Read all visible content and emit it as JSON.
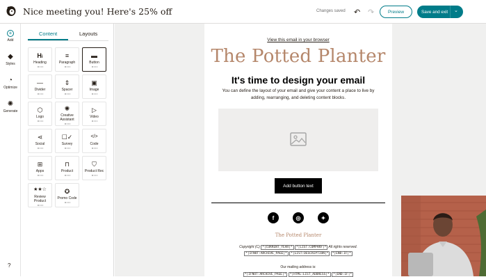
{
  "topbar": {
    "title": "Nice meeting you! Here's 25% off",
    "status": "Changes saved",
    "preview_label": "Preview",
    "save_label": "Save and exit"
  },
  "rail": {
    "add": "Add",
    "styles": "Styles",
    "optimize": "Optimize",
    "generate": "Generate"
  },
  "panel": {
    "tabs": {
      "content": "Content",
      "layouts": "Layouts"
    },
    "blocks": [
      {
        "label": "Heading",
        "icon": "heading-icon"
      },
      {
        "label": "Paragraph",
        "icon": "paragraph-icon"
      },
      {
        "label": "Button",
        "icon": "button-icon"
      },
      {
        "label": "Divider",
        "icon": "divider-icon"
      },
      {
        "label": "Spacer",
        "icon": "spacer-icon"
      },
      {
        "label": "Image",
        "icon": "image-icon"
      },
      {
        "label": "Logo",
        "icon": "logo-icon"
      },
      {
        "label": "Creative Assistant",
        "icon": "creative-assistant-icon"
      },
      {
        "label": "Video",
        "icon": "video-icon"
      },
      {
        "label": "Social",
        "icon": "social-icon"
      },
      {
        "label": "Survey",
        "icon": "survey-icon"
      },
      {
        "label": "Code",
        "icon": "code-icon"
      },
      {
        "label": "Apps",
        "icon": "apps-icon"
      },
      {
        "label": "Product",
        "icon": "product-icon"
      },
      {
        "label": "Product Rec",
        "icon": "product-rec-icon"
      },
      {
        "label": "Review Product",
        "icon": "review-product-icon"
      },
      {
        "label": "Promo Code",
        "icon": "promo-code-icon"
      }
    ]
  },
  "email": {
    "view_link": "View this email in your browser",
    "brand": "The Potted Planter",
    "heading": "It's time to design your email",
    "body": "You can define the layout of your email and give your content a place to live by adding, rearranging, and deleting content blocks.",
    "cta": "Add button text",
    "footer_brand": "The Potted Planter",
    "copyright_prefix": "Copyright (C)",
    "tag_year": "*|CURRENT_YEAR|*",
    "tag_company": "*|LIST:COMPANY|*",
    "rights": "All rights reserved.",
    "tag_ifnot": "*|IFNOT:ARCHIVE_PAGE|*",
    "tag_description": "*|LIST:DESCRIPTION|*",
    "tag_endif": "*|END:IF|*",
    "mailing": "Our mailing address is:",
    "tag_address": "*|HTML:LIST_ADDRESS|*"
  },
  "colors": {
    "accent": "#007c89",
    "brand_text": "#b5876b"
  }
}
